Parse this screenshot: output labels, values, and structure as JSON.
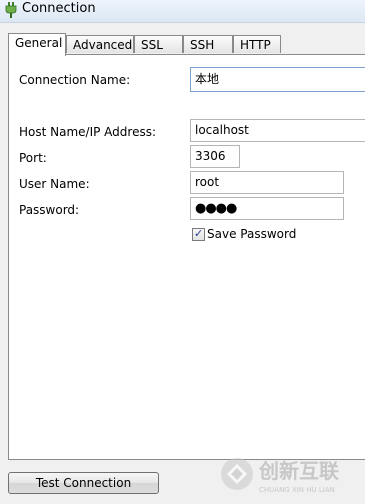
{
  "window": {
    "title": "Connection",
    "icon": "connection-plug-icon"
  },
  "tabs": [
    {
      "label": "General",
      "active": true
    },
    {
      "label": "Advanced",
      "active": false
    },
    {
      "label": "SSL",
      "active": false
    },
    {
      "label": "SSH",
      "active": false
    },
    {
      "label": "HTTP",
      "active": false
    }
  ],
  "form": {
    "connection_name_label": "Connection Name:",
    "connection_name_value": "本地",
    "host_label": "Host Name/IP Address:",
    "host_value": "localhost",
    "port_label": "Port:",
    "port_value": "3306",
    "username_label": "User Name:",
    "username_value": "root",
    "password_label": "Password:",
    "password_value": "●●●●",
    "save_password_label": "Save Password",
    "save_password_checked": true
  },
  "footer": {
    "test_connection_label": "Test Connection"
  },
  "watermark": {
    "brand_text": "创新互联",
    "sub_text": "CHUANG XIN HU LIAN"
  },
  "colors": {
    "titlebar": "#dce7f3",
    "panel": "#ffffff",
    "background": "#f0f0f0"
  }
}
